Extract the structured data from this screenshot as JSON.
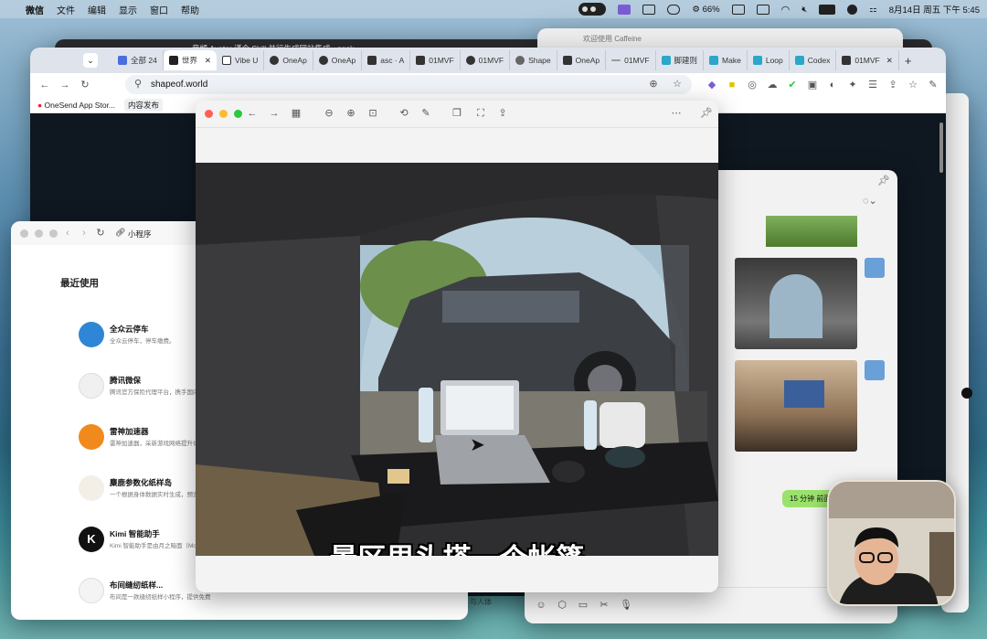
{
  "menubar": {
    "items": [
      "微信",
      "文件",
      "编辑",
      "显示",
      "窗口",
      "帮助"
    ],
    "battery": "66%",
    "datetime": "8月14日 周五 下午 5:45"
  },
  "background_windows": {
    "back_title": "音频 Avatar 谨今 Skill 并行生成网站集成 · geek",
    "caffeine_title": "欢迎使用 Caffeine"
  },
  "browser": {
    "tabs": [
      "全部 24",
      "世界",
      "Vibe U",
      "OneAp",
      "OneAp",
      "asc · A",
      "01MVF",
      "01MVF",
      "Shape",
      "OneAp",
      "01MVF",
      "脚建则",
      "Make",
      "Loop",
      "Codex",
      "01MVF"
    ],
    "active_tab_index": 1,
    "url": "shapeof.world",
    "bookmarks": [
      "OneSend App Stor...",
      "内容发布"
    ]
  },
  "mini_program_window": {
    "address": "小程序",
    "section_title": "最近使用",
    "apps": [
      {
        "name": "全众云停车",
        "desc": "全众云停车，停车缴费。",
        "color": "#2f86d6"
      },
      {
        "name": "腾讯微保",
        "desc": "腾讯官方保险代理平台，携手国内知名",
        "color": "#f0f0f0"
      },
      {
        "name": "雷神加速器",
        "desc": "雷神加速器，采新游戏网络提升体验",
        "color": "#f08a1c"
      },
      {
        "name": "麋鹿参数化纸样岛",
        "desc": "一个根据身体数据实时生成，预览并",
        "color": "#f3efe6"
      },
      {
        "name": "Kimi 智能助手",
        "desc": "Kimi 智能助手是由月之暗面（Moon",
        "color": "#111111"
      },
      {
        "name": "布间缝纫纸样...",
        "desc": "布间是一款缝纫纸样小程序，提供免费",
        "color": "#f4f4f4"
      }
    ]
  },
  "preview": {
    "subtitle": "景区里头搭一个帐篷"
  },
  "chat": {
    "bubble_text": "15 分钟 前面",
    "footer_text": "与人体"
  },
  "colors": {
    "accent": "#7b5cd6",
    "chat_bubble": "#9be26b"
  }
}
